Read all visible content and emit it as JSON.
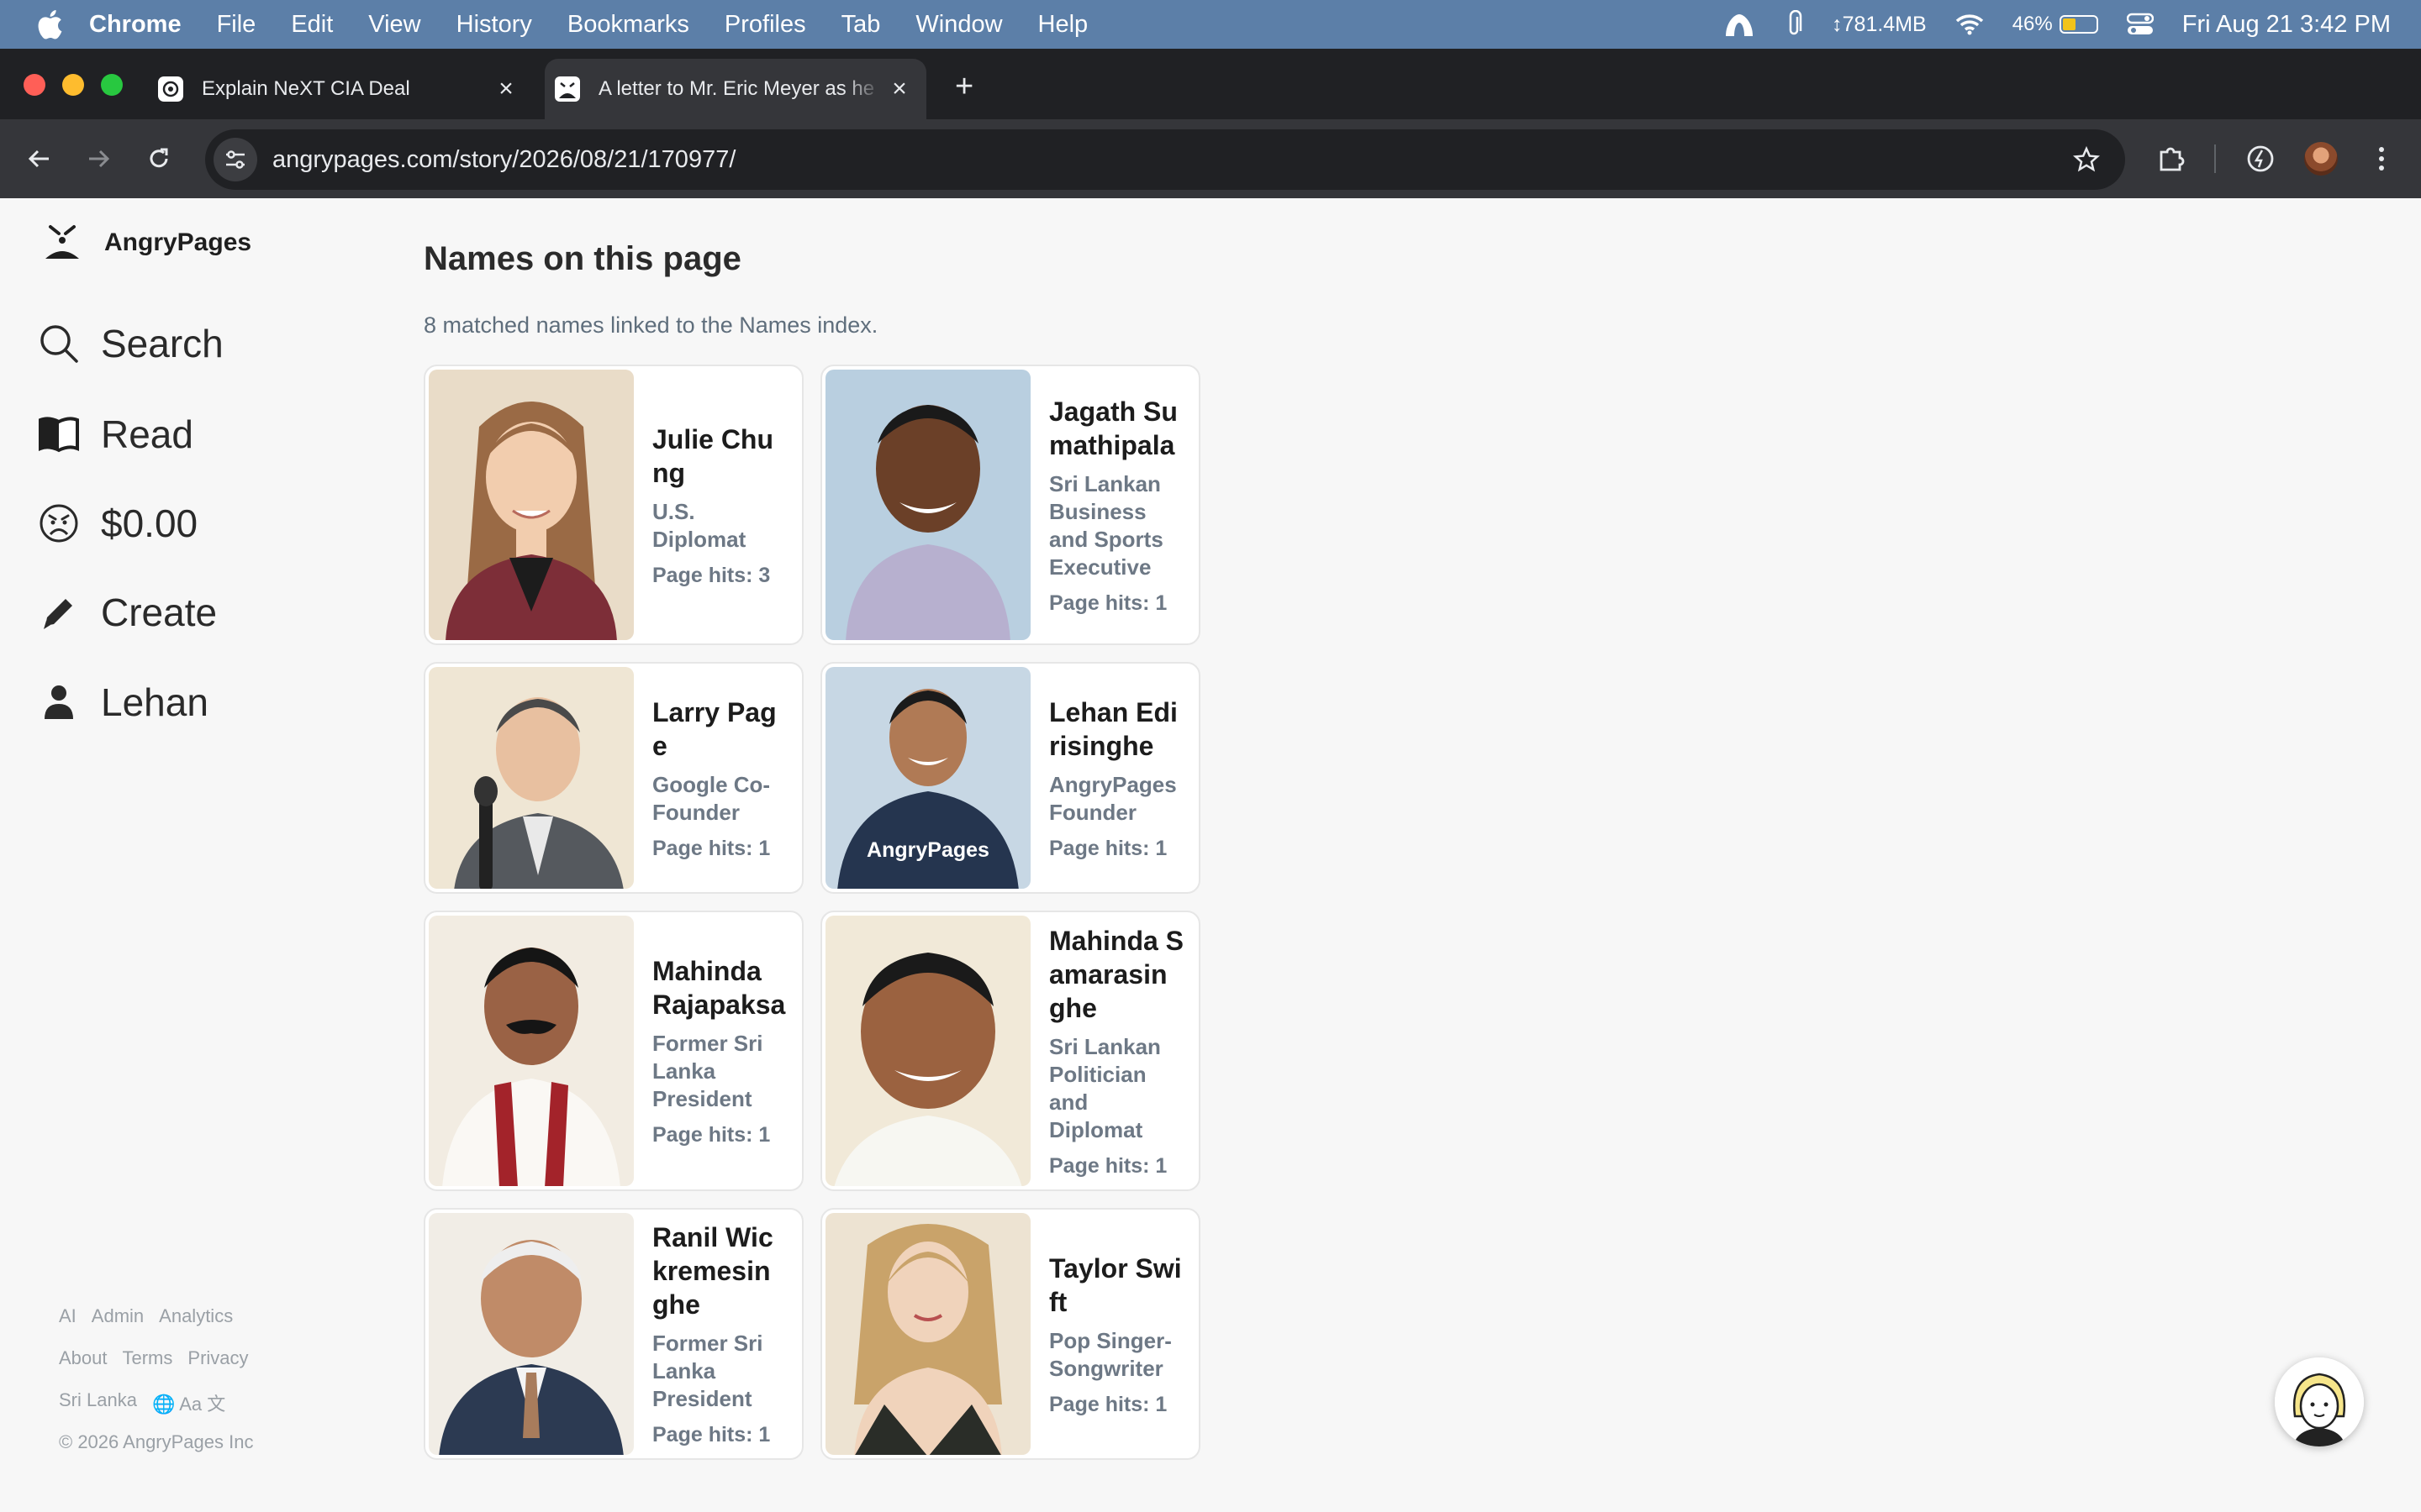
{
  "menubar": {
    "app": "Chrome",
    "items": [
      "File",
      "Edit",
      "View",
      "History",
      "Bookmarks",
      "Profiles",
      "Tab",
      "Window",
      "Help"
    ],
    "net_rate": "↕781.4MB",
    "battery_pct": "46%",
    "battery_level": 0.46,
    "clock": "Fri Aug 21  3:42 PM"
  },
  "tabs": [
    {
      "title": "Explain NeXT CIA Deal",
      "favicon": "openai-icon"
    },
    {
      "title": "A letter to Mr. Eric Meyer as he",
      "favicon": "angrypages-icon",
      "active": true
    }
  ],
  "toolbar": {
    "url": "angrypages.com/story/2026/08/21/170977/"
  },
  "sidebar": {
    "brand": "AngryPages",
    "nav": {
      "search": "Search",
      "read": "Read",
      "balance": "$0.00",
      "create": "Create",
      "user": "Lehan"
    },
    "footer": {
      "row1": [
        "AI",
        "Admin",
        "Analytics"
      ],
      "row2": [
        "About",
        "Terms",
        "Privacy"
      ],
      "row3": [
        "Sri Lanka",
        "🌐 Aa 文"
      ],
      "copyright": "© 2026 AngryPages Inc"
    }
  },
  "main": {
    "title": "Names on this page",
    "subtitle": "8 matched names linked to the Names index.",
    "cards": [
      {
        "name": "Julie Chung",
        "role": "U.S. Diplomat",
        "hits": "Page hits: 3"
      },
      {
        "name": "Jagath Sumathipala",
        "role": "Sri Lankan Business and Sports Executive",
        "hits": "Page hits: 1"
      },
      {
        "name": "Larry Page",
        "role": "Google Co-Founder",
        "hits": "Page hits: 1"
      },
      {
        "name": "Lehan Edirisinghe",
        "role": "AngryPages Founder",
        "hits": "Page hits: 1",
        "shirt_text": "AngryPages"
      },
      {
        "name": "Mahinda Rajapaksa",
        "role": "Former Sri Lanka President",
        "hits": "Page hits: 1"
      },
      {
        "name": "Mahinda Samarasinghe",
        "role": "Sri Lankan Politician and Diplomat",
        "hits": "Page hits: 1"
      },
      {
        "name": "Ranil Wickremesinghe",
        "role": "Former Sri Lanka President",
        "hits": "Page hits: 1"
      },
      {
        "name": "Taylor Swift",
        "role": "Pop Singer-Songwriter",
        "hits": "Page hits: 1"
      }
    ]
  },
  "colors": {
    "menubar": "#5c7fa8",
    "tabstrip": "#202124",
    "toolbar": "#35363a",
    "page_bg": "#f7f7f7",
    "role_text": "#6d7885"
  }
}
